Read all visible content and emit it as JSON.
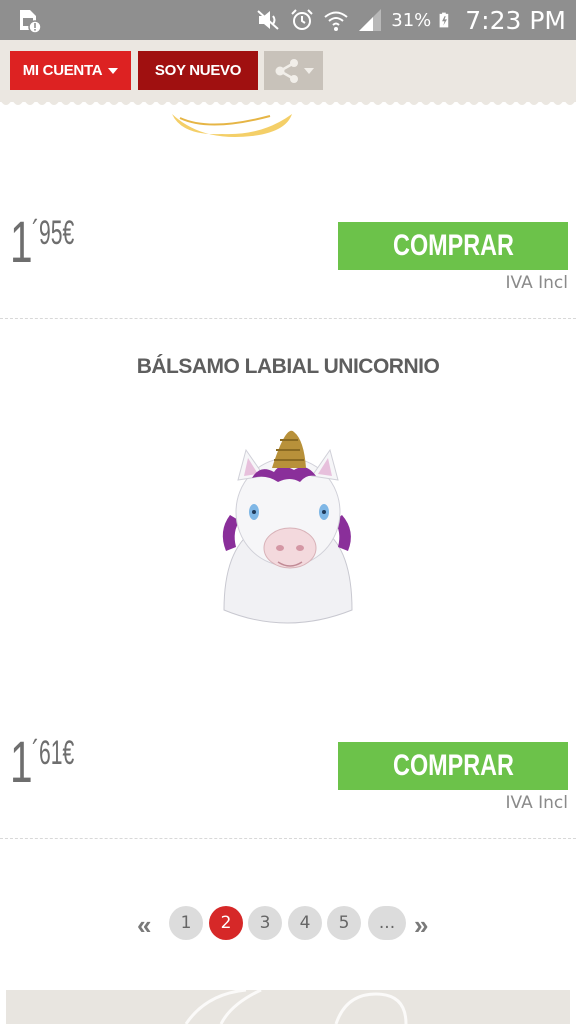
{
  "status_bar": {
    "battery": "31%",
    "time": "7:23 PM"
  },
  "header": {
    "account_label": "MI CUENTA",
    "new_user_label": "SOY NUEVO"
  },
  "products": [
    {
      "price_int": "1",
      "price_dec": "´95€",
      "buy_label": "COMPRAR",
      "vat_note": "IVA Incl"
    },
    {
      "title": "BÁLSAMO LABIAL UNICORNIO",
      "price_int": "1",
      "price_dec": "´61€",
      "buy_label": "COMPRAR",
      "vat_note": "IVA Incl"
    }
  ],
  "pagination": {
    "prev": "«",
    "pages": [
      "1",
      "2",
      "3",
      "4",
      "5",
      "..."
    ],
    "current": "2",
    "next": "»"
  },
  "colors": {
    "account_red": "#dd2222",
    "new_dark_red": "#a01010",
    "buy_green": "#6cc24a",
    "active_page": "#d62828"
  }
}
